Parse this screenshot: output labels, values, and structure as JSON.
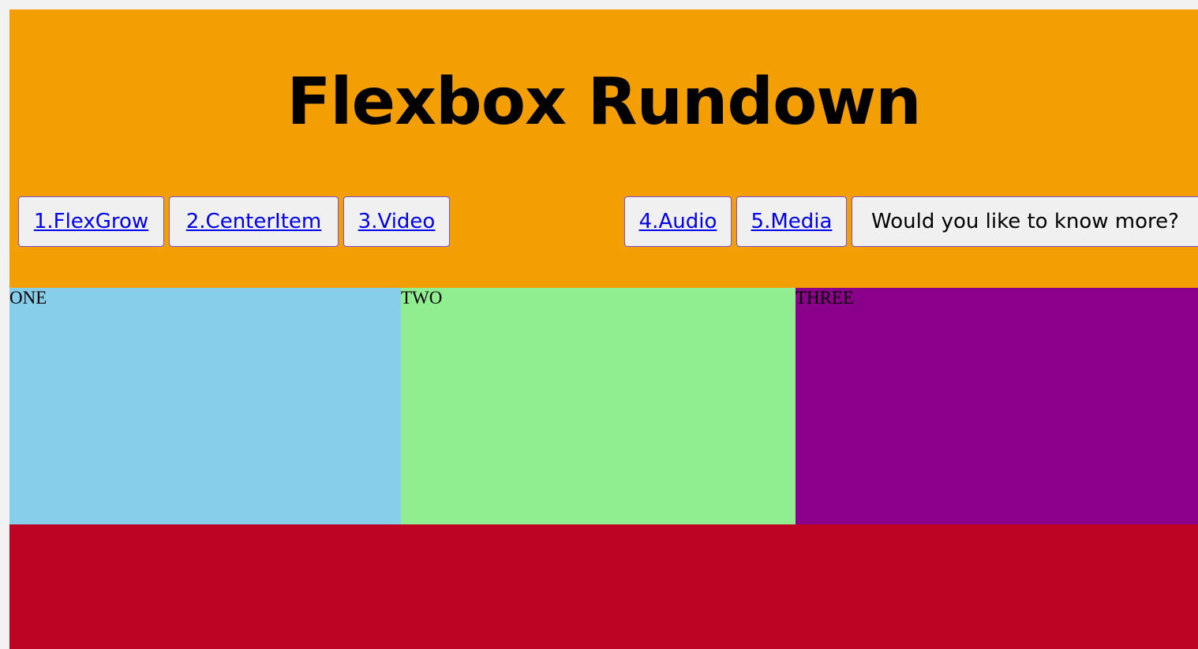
{
  "header": {
    "title": "Flexbox Rundown",
    "background": "#f39f04"
  },
  "nav": {
    "items": [
      {
        "label": "1.FlexGrow"
      },
      {
        "label": "2.CenterItem"
      },
      {
        "label": "3.Video"
      },
      {
        "label": "4.Audio"
      },
      {
        "label": "5.Media"
      }
    ],
    "cta": "Would you like to know more?"
  },
  "boxes": [
    {
      "label": "ONE",
      "color": "#87ceeb"
    },
    {
      "label": "TWO",
      "color": "#90ee90"
    },
    {
      "label": "THREE",
      "color": "#8b008b"
    }
  ],
  "footer": {
    "color": "#be0424"
  }
}
